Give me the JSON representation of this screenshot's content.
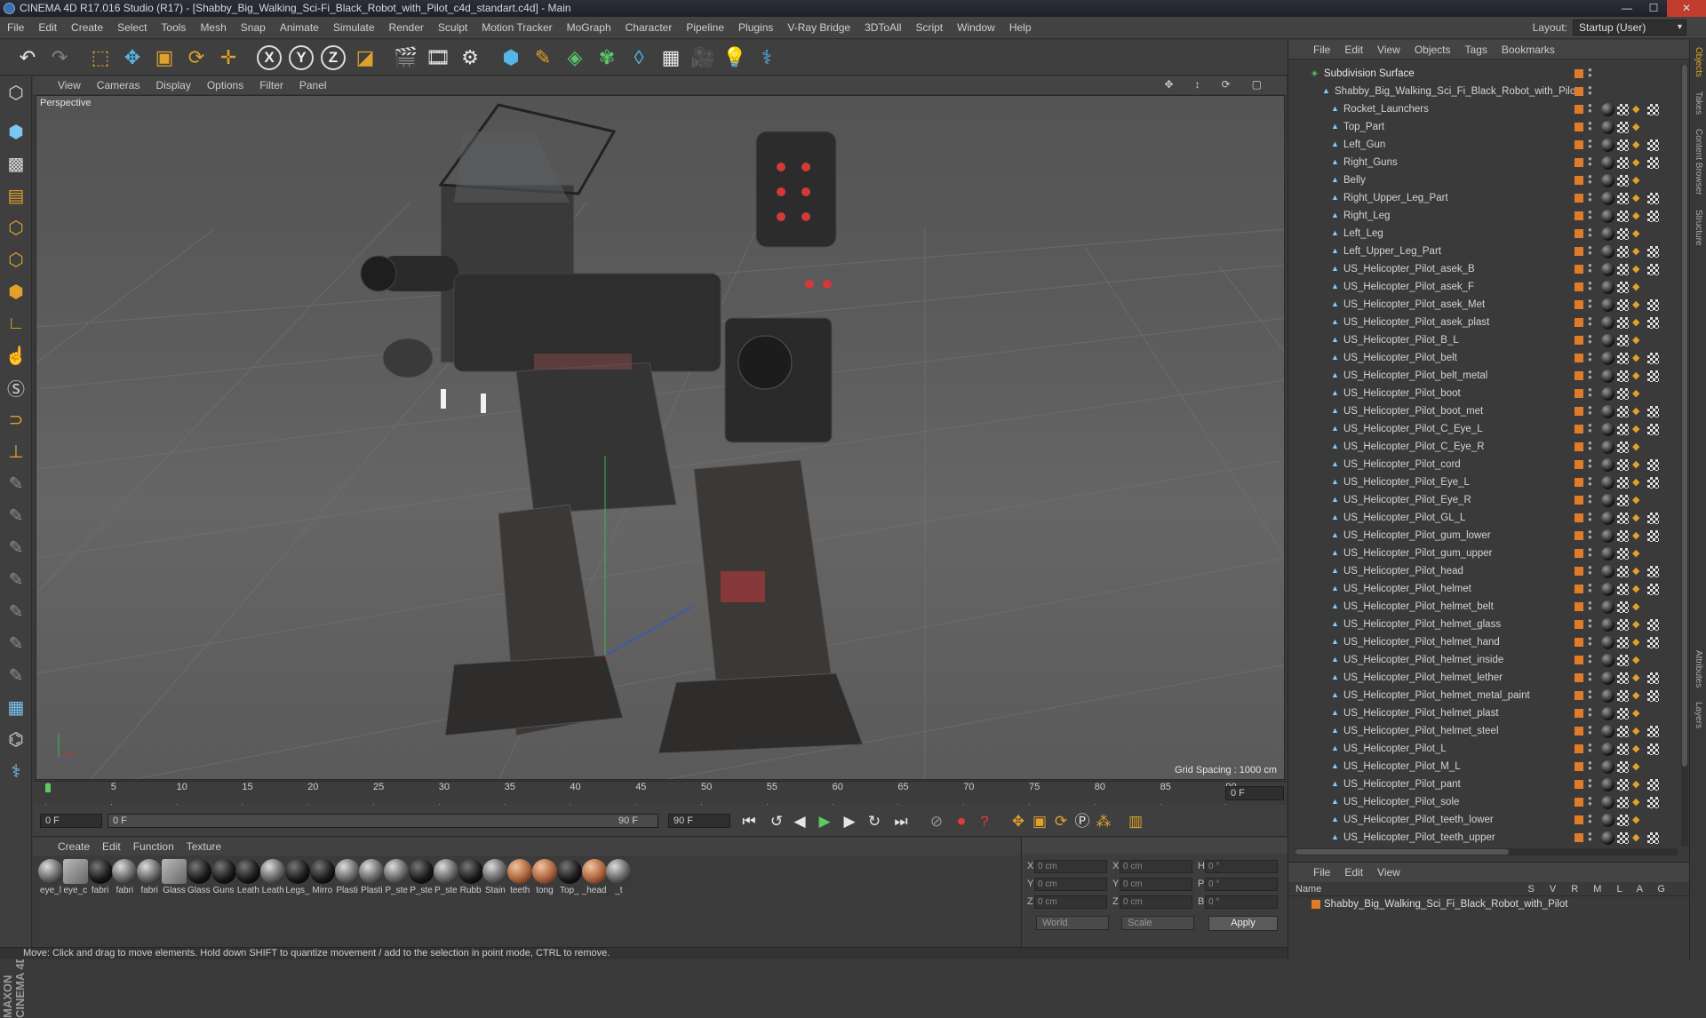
{
  "window": {
    "title": "CINEMA 4D R17.016 Studio (R17) - [Shabby_Big_Walking_Sci-Fi_Black_Robot_with_Pilot_c4d_standart.c4d] - Main"
  },
  "menu": [
    "File",
    "Edit",
    "Create",
    "Select",
    "Tools",
    "Mesh",
    "Snap",
    "Animate",
    "Simulate",
    "Render",
    "Sculpt",
    "Motion Tracker",
    "MoGraph",
    "Character",
    "Pipeline",
    "Plugins",
    "V-Ray Bridge",
    "3DToAll",
    "Script",
    "Window",
    "Help"
  ],
  "layout": {
    "label": "Layout:",
    "value": "Startup (User)"
  },
  "viewport": {
    "menu": [
      "View",
      "Cameras",
      "Display",
      "Options",
      "Filter",
      "Panel"
    ],
    "camera_label": "Perspective",
    "grid_spacing": "Grid Spacing : 1000 cm"
  },
  "timeline": {
    "ticks": [
      "0",
      "5",
      "10",
      "15",
      "20",
      "25",
      "30",
      "35",
      "40",
      "45",
      "50",
      "55",
      "60",
      "65",
      "70",
      "75",
      "80",
      "85",
      "90"
    ],
    "current_frame": "0 F",
    "start_frame": "0 F",
    "range_start": "0 F",
    "range_end": "90 F",
    "end_frame": "90 F"
  },
  "materials": {
    "menu": [
      "Create",
      "Edit",
      "Function",
      "Texture"
    ],
    "items": [
      {
        "label": "eye_l",
        "kind": "grey"
      },
      {
        "label": "eye_c",
        "kind": "glass"
      },
      {
        "label": "fabri",
        "kind": "dark"
      },
      {
        "label": "fabri",
        "kind": "grey"
      },
      {
        "label": "fabri",
        "kind": "grey"
      },
      {
        "label": "Glass",
        "kind": "glass"
      },
      {
        "label": "Glass",
        "kind": "dark"
      },
      {
        "label": "Guns",
        "kind": "dark"
      },
      {
        "label": "Leath",
        "kind": "dark"
      },
      {
        "label": "Leath",
        "kind": "grey"
      },
      {
        "label": "Legs_",
        "kind": "dark"
      },
      {
        "label": "Mirro",
        "kind": "dark"
      },
      {
        "label": "Plasti",
        "kind": "grey"
      },
      {
        "label": "Plasti",
        "kind": "grey"
      },
      {
        "label": "P_ste",
        "kind": "grey"
      },
      {
        "label": "P_ste",
        "kind": "dark"
      },
      {
        "label": "P_ste",
        "kind": "grey"
      },
      {
        "label": "Rubb",
        "kind": "dark"
      },
      {
        "label": "Stain",
        "kind": "grey"
      },
      {
        "label": "teeth",
        "kind": "skin"
      },
      {
        "label": "tong",
        "kind": "skin"
      },
      {
        "label": "Top_",
        "kind": "dark"
      },
      {
        "label": "_head",
        "kind": "skin"
      },
      {
        "label": "_t",
        "kind": "grey"
      }
    ]
  },
  "coords": {
    "rows": [
      {
        "a": "X",
        "av": "0 cm",
        "b": "X",
        "bv": "0 cm",
        "c": "H",
        "cv": "0 °"
      },
      {
        "a": "Y",
        "av": "0 cm",
        "b": "Y",
        "bv": "0 cm",
        "c": "P",
        "cv": "0 °"
      },
      {
        "a": "Z",
        "av": "0 cm",
        "b": "Z",
        "bv": "0 cm",
        "c": "B",
        "cv": "0 °"
      }
    ],
    "world": "World",
    "scale": "Scale",
    "apply": "Apply"
  },
  "status": "Move: Click and drag to move elements. Hold down SHIFT to quantize movement / add to the selection in point mode, CTRL to remove.",
  "object_manager": {
    "menu": [
      "File",
      "Edit",
      "View",
      "Objects",
      "Tags",
      "Bookmarks"
    ],
    "root": "Subdivision Surface",
    "group": "Shabby_Big_Walking_Sci_Fi_Black_Robot_with_Pilot",
    "objects": [
      "Rocket_Launchers",
      "Top_Part",
      "Left_Gun",
      "Right_Guns",
      "Belly",
      "Right_Upper_Leg_Part",
      "Right_Leg",
      "Left_Leg",
      "Left_Upper_Leg_Part",
      "US_Helicopter_Pilot_asek_B",
      "US_Helicopter_Pilot_asek_F",
      "US_Helicopter_Pilot_asek_Met",
      "US_Helicopter_Pilot_asek_plast",
      "US_Helicopter_Pilot_B_L",
      "US_Helicopter_Pilot_belt",
      "US_Helicopter_Pilot_belt_metal",
      "US_Helicopter_Pilot_boot",
      "US_Helicopter_Pilot_boot_met",
      "US_Helicopter_Pilot_C_Eye_L",
      "US_Helicopter_Pilot_C_Eye_R",
      "US_Helicopter_Pilot_cord",
      "US_Helicopter_Pilot_Eye_L",
      "US_Helicopter_Pilot_Eye_R",
      "US_Helicopter_Pilot_GL_L",
      "US_Helicopter_Pilot_gum_lower",
      "US_Helicopter_Pilot_gum_upper",
      "US_Helicopter_Pilot_head",
      "US_Helicopter_Pilot_helmet",
      "US_Helicopter_Pilot_helmet_belt",
      "US_Helicopter_Pilot_helmet_glass",
      "US_Helicopter_Pilot_helmet_hand",
      "US_Helicopter_Pilot_helmet_inside",
      "US_Helicopter_Pilot_helmet_lether",
      "US_Helicopter_Pilot_helmet_metal_paint",
      "US_Helicopter_Pilot_helmet_plast",
      "US_Helicopter_Pilot_helmet_steel",
      "US_Helicopter_Pilot_L",
      "US_Helicopter_Pilot_M_L",
      "US_Helicopter_Pilot_pant",
      "US_Helicopter_Pilot_sole",
      "US_Helicopter_Pilot_teeth_lower",
      "US_Helicopter_Pilot_teeth_upper"
    ]
  },
  "attribute_manager": {
    "menu": [
      "File",
      "Edit",
      "View"
    ],
    "name_header": "Name",
    "columns": "S V R M L A G",
    "row": "Shabby_Big_Walking_Sci_Fi_Black_Robot_with_Pilot"
  },
  "side_tabs": [
    "Objects",
    "Takes",
    "Content Browser",
    "Structure",
    "Attributes",
    "Layers"
  ],
  "colors": {
    "accent": "#e0a22a",
    "object_tag": "#e07b2a",
    "play": "#5fc85f",
    "record": "#e53b3b"
  }
}
